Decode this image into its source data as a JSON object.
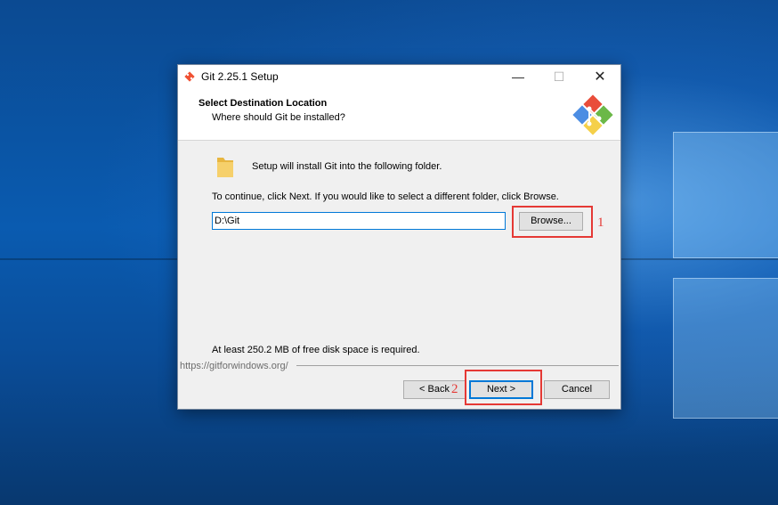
{
  "window": {
    "title": "Git 2.25.1 Setup",
    "controls": {
      "minimize": "—",
      "maximize": "☐",
      "close": "✕"
    }
  },
  "header": {
    "title": "Select Destination Location",
    "subtitle": "Where should Git be installed?"
  },
  "body": {
    "intro": "Setup will install Git into the following folder.",
    "instruction": "To continue, click Next. If you would like to select a different folder, click Browse.",
    "install_path": "D:\\Git",
    "browse_label": "Browse...",
    "disk_space": "At least 250.2 MB of free disk space is required."
  },
  "footer": {
    "url": "https://gitforwindows.org/",
    "back_label": "< Back",
    "next_label": "Next >",
    "cancel_label": "Cancel"
  },
  "annotations": [
    {
      "number": "1",
      "target": "browse-button"
    },
    {
      "number": "2",
      "target": "next-button"
    }
  ],
  "colors": {
    "annotation": "#e53935",
    "focus": "#0078d7"
  }
}
